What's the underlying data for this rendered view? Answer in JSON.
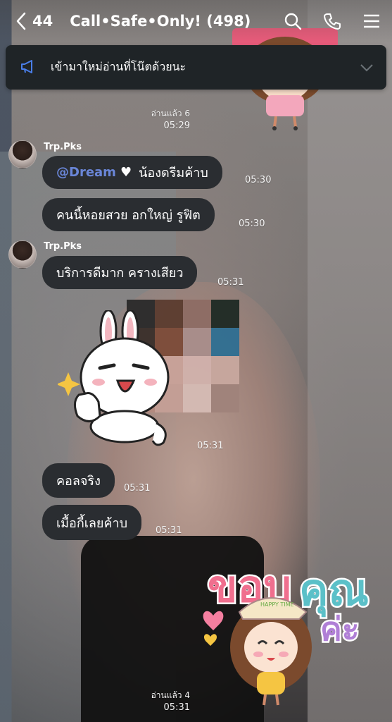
{
  "header": {
    "back_count": "44",
    "title": "Call•Safe•Only! (498)"
  },
  "announcement": {
    "text": "เข้ามาใหม่อ่านที่โน๊ตด้วยนะ"
  },
  "read_markers": [
    {
      "label": "อ่านแล้ว 6",
      "time": "05:29"
    },
    {
      "label": "อ่านแล้ว 4",
      "time": "05:31"
    }
  ],
  "messages": [
    {
      "sender": "Trp.Pks",
      "mention": "@Dream",
      "text": "น้องดรีมค้าบ",
      "time": "05:30"
    },
    {
      "text": "คนนี้หอยสวย อกใหญ่ รูฟิต",
      "time": "05:30"
    },
    {
      "sender": "Trp.Pks",
      "text": "บริการดีมาก ครางเสียว",
      "time": "05:31"
    },
    {
      "sticker": "rabbit-thumbs-up-sticker",
      "time": "05:31"
    },
    {
      "text": "คอลจริง",
      "time": "05:31"
    },
    {
      "text": "เมื้อกี้เลยค้าบ",
      "time": "05:31"
    }
  ],
  "sticker_bottom": {
    "text": "ขอบคุณค่ะ",
    "hat_text": "HAPPY TIME"
  },
  "colors": {
    "bubble": "#2a2d31",
    "mention": "#6a86d8",
    "announcement_bg": "#1f2427"
  }
}
